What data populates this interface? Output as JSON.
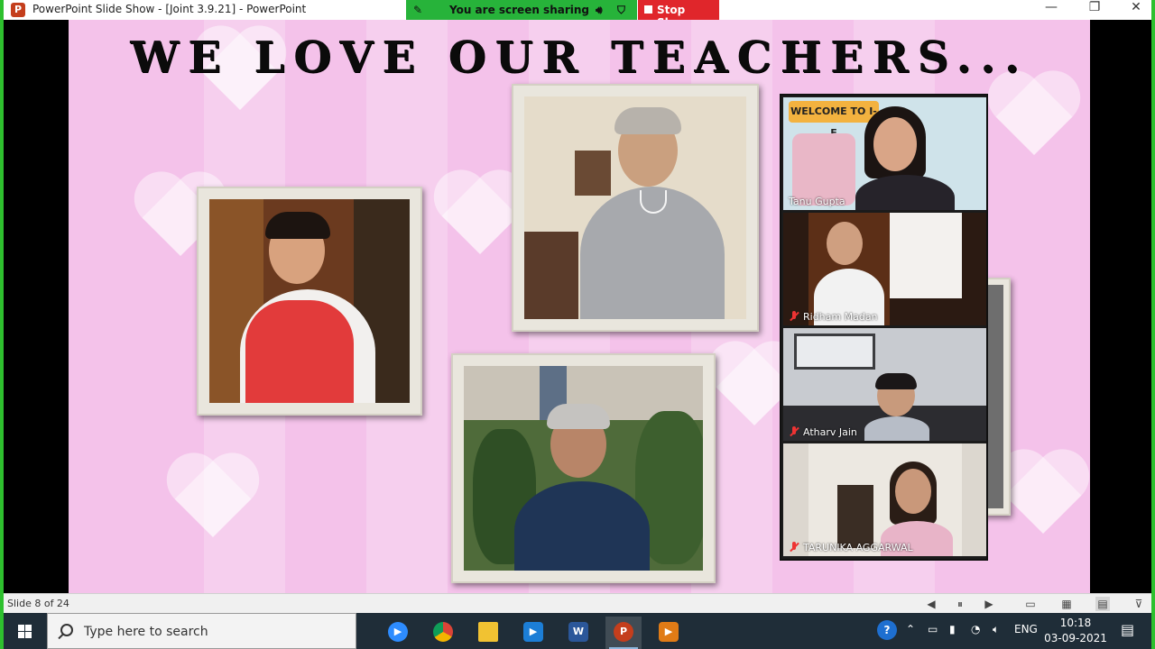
{
  "window": {
    "title": "PowerPoint Slide Show - [Joint 3.9.21] - PowerPoint",
    "app_icon": "powerpoint-icon",
    "app_icon_letter": "P",
    "minimize_glyph": "—",
    "maximize_glyph": "❐",
    "close_glyph": "✕"
  },
  "share": {
    "banner_text": "You are screen sharing",
    "stop_label": "Stop Share",
    "banner_color": "#27b33a",
    "stop_color": "#e0262b"
  },
  "slide": {
    "title": "WE LOVE OUR TEACHERS...",
    "background": "#f4c2ea"
  },
  "participants": [
    {
      "name": "Tanu Gupta",
      "muted": false
    },
    {
      "name": "Ridham Madan",
      "muted": true
    },
    {
      "name": "Atharv Jain",
      "muted": true
    },
    {
      "name": "TARUNIKA AGGARWAL",
      "muted": true
    }
  ],
  "welcome_sign": "WELCOME TO I-E",
  "statusbar": {
    "slide_indicator": "Slide 8 of 24"
  },
  "taskbar": {
    "search_placeholder": "Type here to search",
    "apps": [
      {
        "name": "zoom",
        "icon": "zoom-icon",
        "color": "#2d8cff"
      },
      {
        "name": "chrome",
        "icon": "chrome-icon",
        "color": "#e7ae1d"
      },
      {
        "name": "file-explorer",
        "icon": "folder-icon",
        "color": "#f1c232"
      },
      {
        "name": "video-editor",
        "icon": "video-icon",
        "color": "#1c7ed6"
      },
      {
        "name": "word",
        "icon": "word-icon",
        "color": "#2b579a",
        "letter": "W"
      },
      {
        "name": "powerpoint",
        "icon": "powerpoint-icon",
        "color": "#c43e1c",
        "letter": "P"
      },
      {
        "name": "media-player",
        "icon": "media-player-icon",
        "color": "#e07b16"
      }
    ],
    "language": "ENG",
    "time": "10:18",
    "date": "03-09-2021"
  }
}
